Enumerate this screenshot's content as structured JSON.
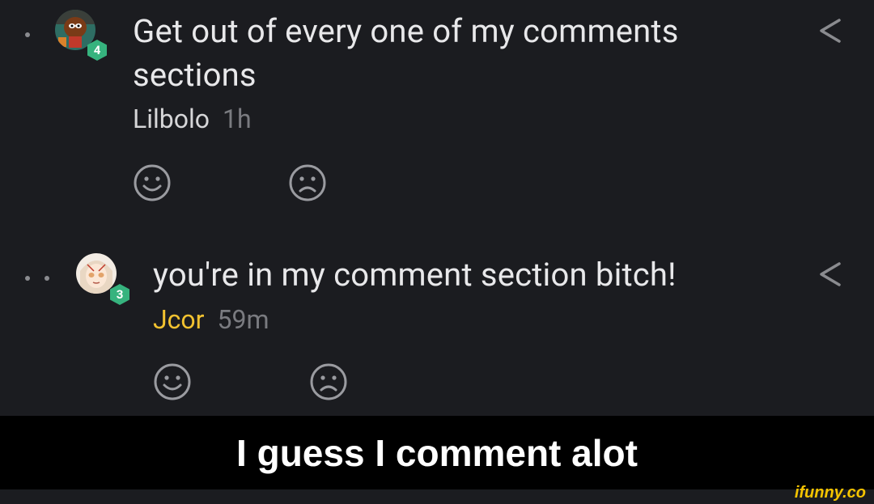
{
  "comments": [
    {
      "text": "Get out of every one of my comments sections",
      "author": "Lilbolo",
      "time": "1h",
      "level": "4",
      "level_color": "#36b37e",
      "author_color": "#d6d6d8",
      "avatar_icon": "cartoon-character-avatar-icon"
    },
    {
      "text": "you're in my comment section bitch!",
      "author": "Jcor",
      "time": "59m",
      "level": "3",
      "level_color": "#36b37e",
      "author_color": "#f2c230",
      "avatar_icon": "anime-girl-avatar-icon"
    }
  ],
  "caption": "I guess I comment alot",
  "watermark": "ifunny.co",
  "colors": {
    "background": "#1b1c20",
    "text": "#e8e8ea",
    "muted": "#7a7b80",
    "icon": "#9a9ba0",
    "caption_bar": "#000000",
    "watermark": "#f5c400"
  }
}
